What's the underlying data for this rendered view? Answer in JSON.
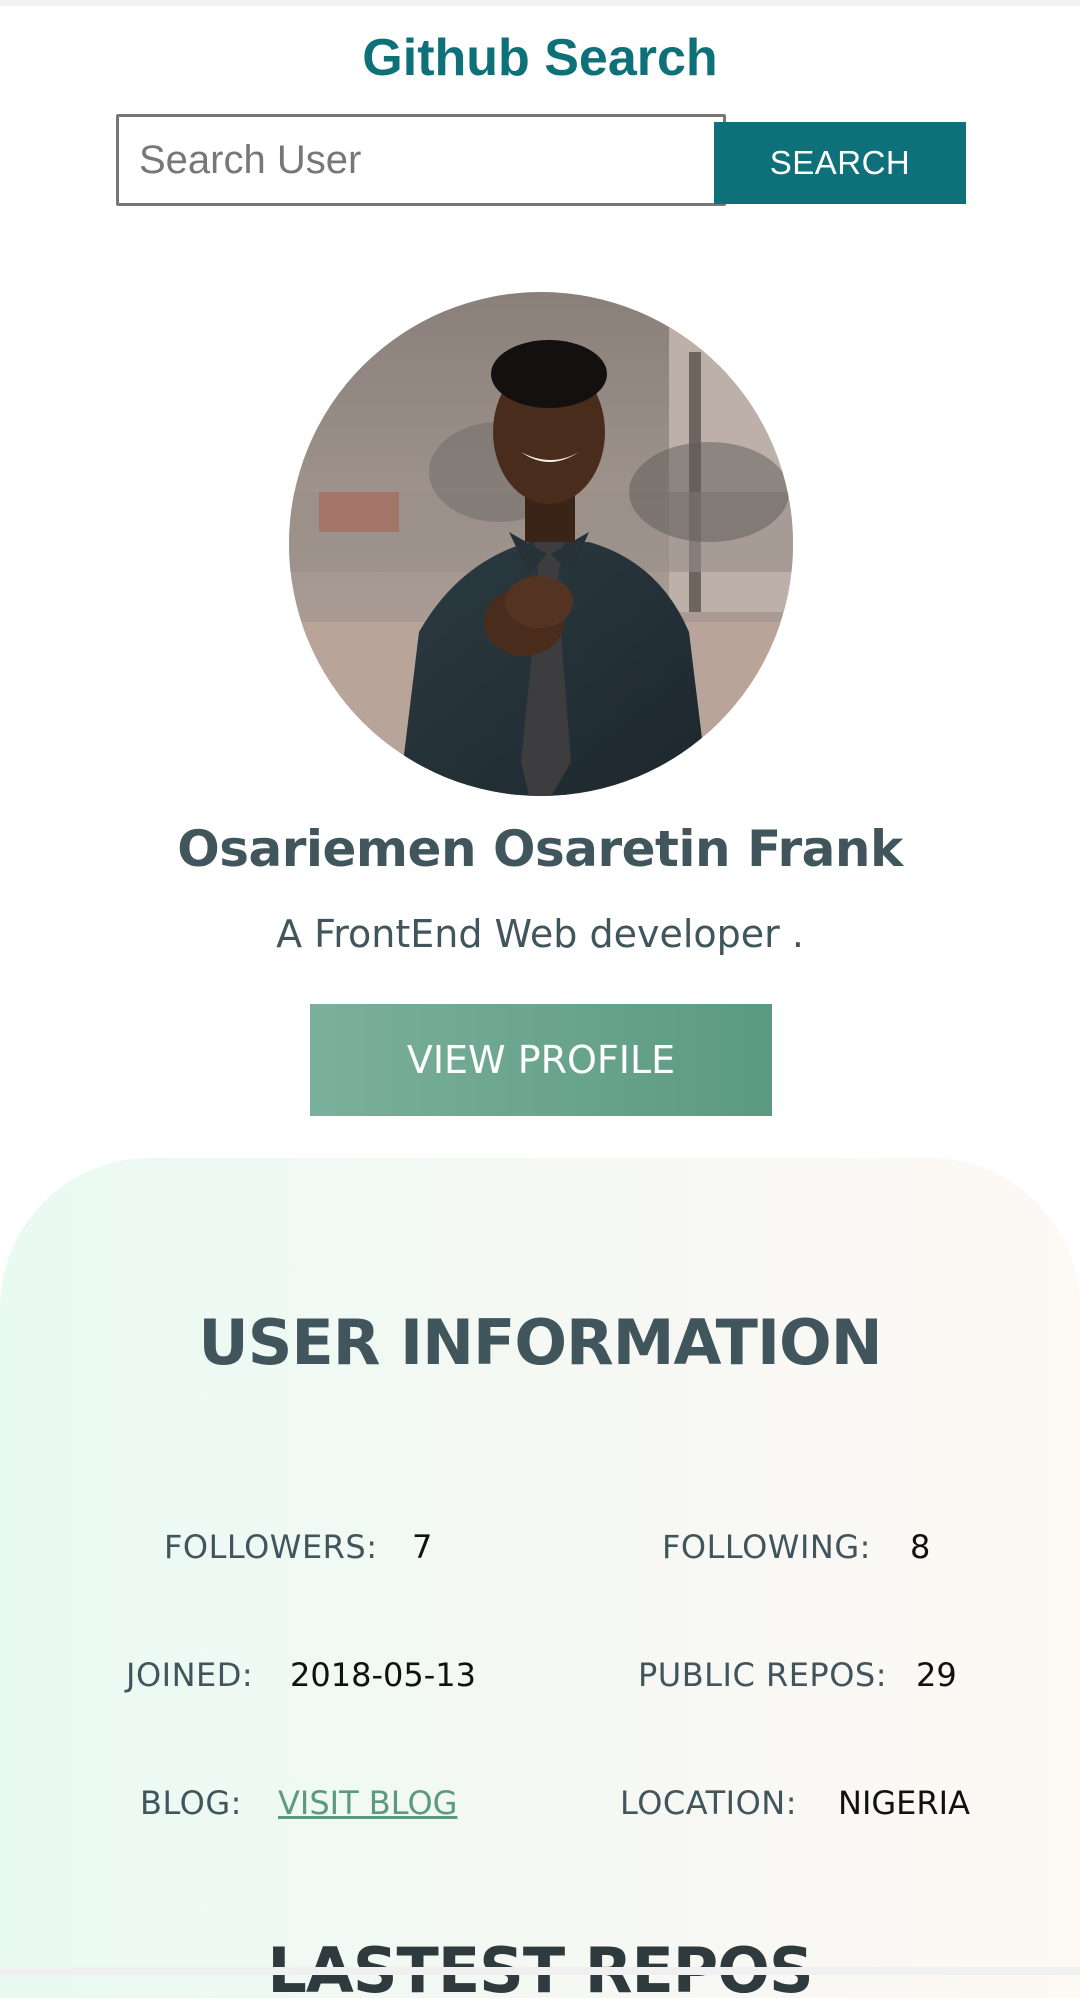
{
  "header": {
    "title": "Github Search"
  },
  "search": {
    "placeholder": "Search User",
    "value": "",
    "button_label": "SEARCH"
  },
  "profile": {
    "name": "Osariemen Osaretin Frank",
    "bio": "A FrontEnd Web developer .",
    "view_profile_label": "VIEW PROFILE"
  },
  "user_info": {
    "title": "USER INFORMATION",
    "followers_label": "FOLLOWERS:",
    "followers_value": "7",
    "following_label": "FOLLOWING:",
    "following_value": "8",
    "joined_label": "JOINED:",
    "joined_value": "2018-05-13",
    "public_repos_label": "PUBLIC REPOS:",
    "public_repos_value": "29",
    "blog_label": "BLOG:",
    "blog_link_label": "VISIT BLOG",
    "location_label": "LOCATION:",
    "location_value": "NIGERIA"
  },
  "repos": {
    "title": "LASTEST REPOS"
  },
  "colors": {
    "brand": "#0e7078",
    "text_dark": "#41565c",
    "accent_green": "#5b9a80"
  }
}
